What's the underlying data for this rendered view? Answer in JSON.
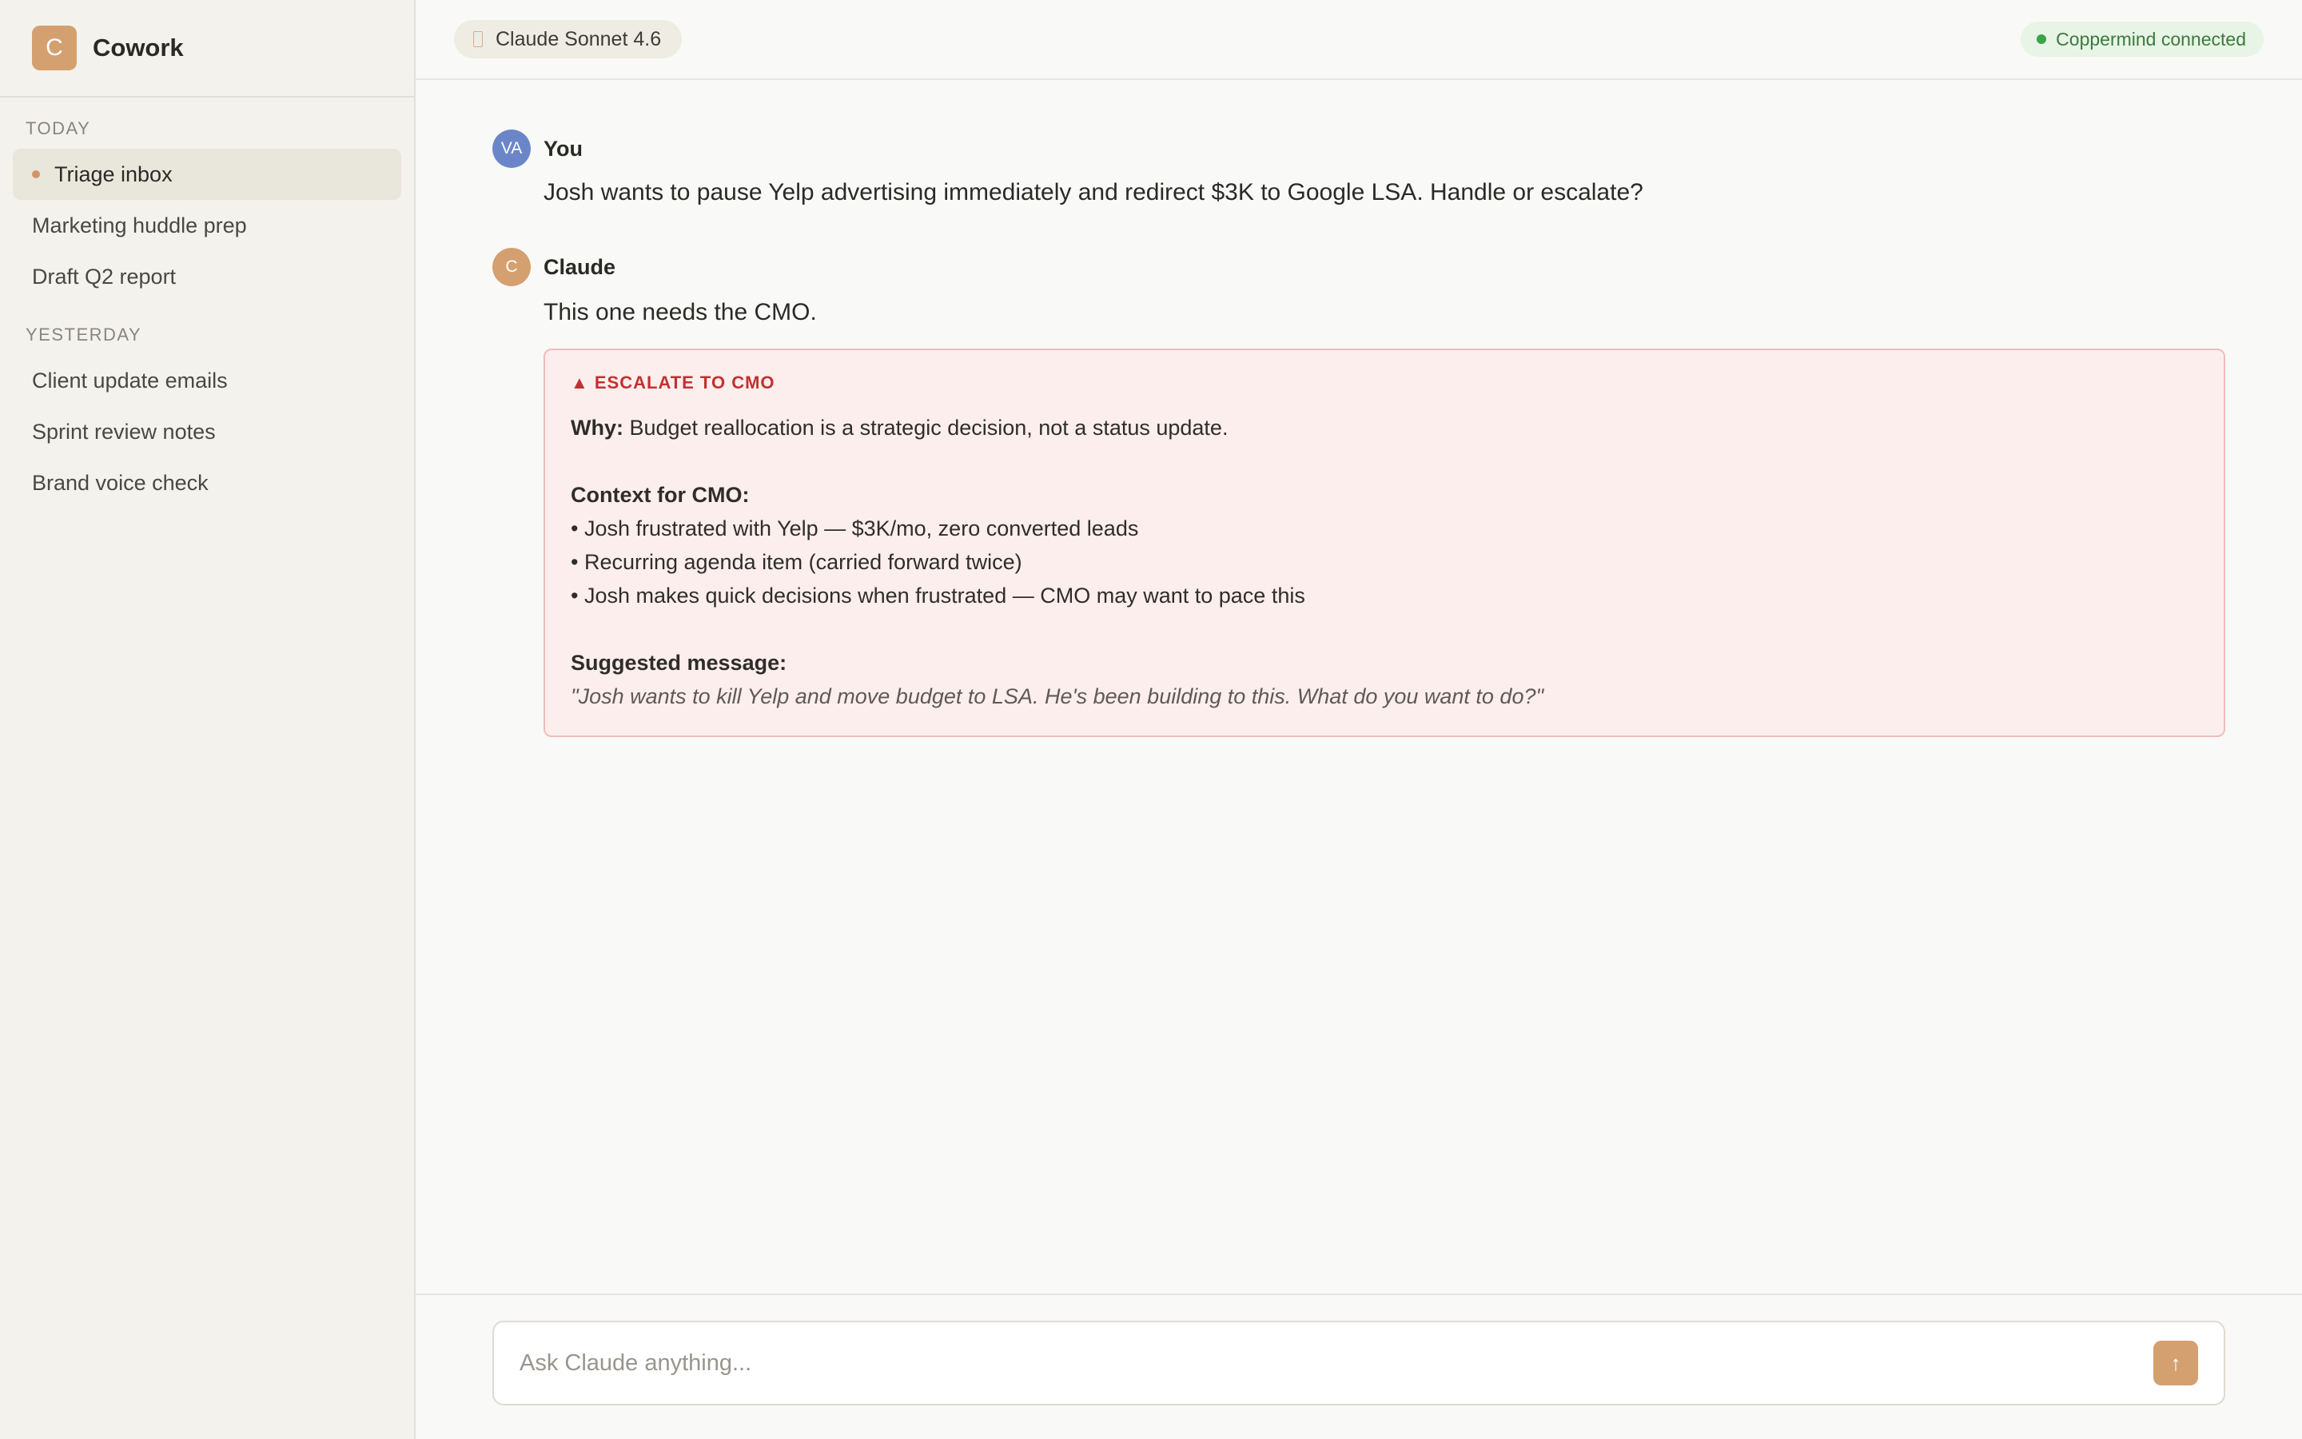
{
  "app": {
    "logo_letter": "C",
    "name": "Cowork"
  },
  "sidebar": {
    "sections": [
      {
        "label": "TODAY",
        "items": [
          {
            "label": "Triage inbox",
            "active": true
          },
          {
            "label": "Marketing huddle prep"
          },
          {
            "label": "Draft Q2 report"
          }
        ]
      },
      {
        "label": "YESTERDAY",
        "items": [
          {
            "label": "Client update emails"
          },
          {
            "label": "Sprint review notes"
          },
          {
            "label": "Brand voice check"
          }
        ]
      }
    ]
  },
  "topbar": {
    "model_label": "Claude Sonnet 4.6",
    "connection_label": "Coppermind connected"
  },
  "conversation": {
    "user": {
      "avatar": "VA",
      "author": "You",
      "text": "Josh wants to pause Yelp advertising immediately and redirect $3K to Google LSA. Handle or escalate?"
    },
    "claude": {
      "avatar": "C",
      "author": "Claude",
      "text": "This one needs the CMO.",
      "card": {
        "title": "▲ ESCALATE TO CMO",
        "why_label": "Why:",
        "why_text": " Budget reallocation is a strategic decision, not a status update.",
        "context_label": "Context for CMO:",
        "bullets": [
          "• Josh frustrated with Yelp — $3K/mo, zero converted leads",
          "• Recurring agenda item (carried forward twice)",
          "• Josh makes quick decisions when frustrated — CMO may want to pace this"
        ],
        "suggested_label": "Suggested message:",
        "suggested_text": "\"Josh wants to kill Yelp and move budget to LSA. He's been building to this. What do you want to do?\""
      }
    }
  },
  "composer": {
    "placeholder": "Ask Claude anything...",
    "send_icon": "↑"
  },
  "colors": {
    "accent": "#d4a070",
    "user_avatar": "#6b86c8",
    "escalate": "#c33030",
    "connected": "#3aa447"
  }
}
